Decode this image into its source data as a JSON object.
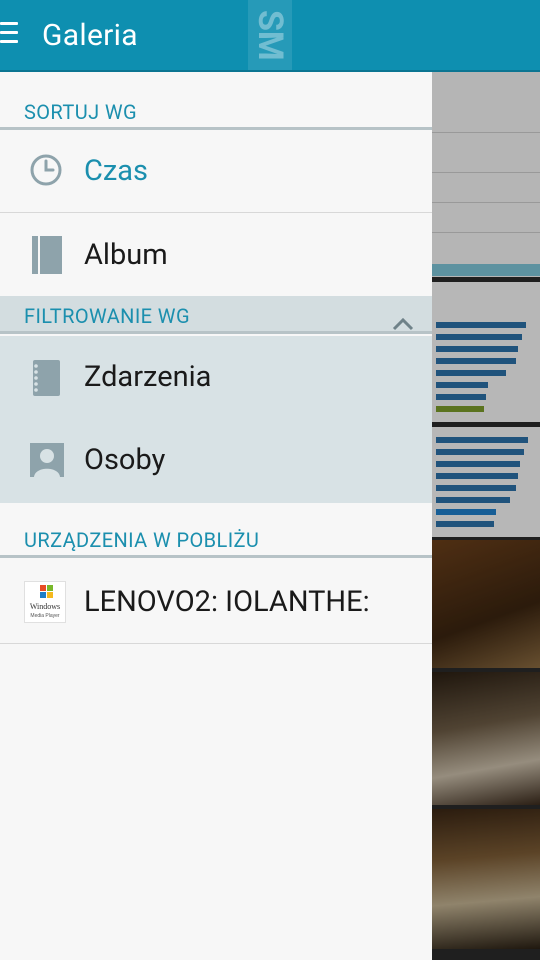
{
  "app": {
    "title": "Galeria",
    "watermark": "SM"
  },
  "drawer": {
    "sort_header": "SORTUJ WG",
    "sort_items": [
      {
        "label": "Czas",
        "icon": "clock-icon",
        "active": true
      },
      {
        "label": "Album",
        "icon": "album-icon",
        "active": false
      }
    ],
    "filter_header": "FILTROWANIE WG",
    "filter_items": [
      {
        "label": "Zdarzenia",
        "icon": "notebook-icon"
      },
      {
        "label": "Osoby",
        "icon": "person-icon"
      }
    ],
    "devices_header": "URZĄDZENIA W POBLIŻU",
    "device_items": [
      {
        "label": "LENOVO2: IOLANTHE:",
        "icon": "windows-media-player-icon",
        "icon_text_1": "Windows",
        "icon_text_2": "Media Player"
      }
    ]
  },
  "colors": {
    "accent": "#0e8fb0",
    "section_text": "#1b8fae",
    "filter_bg": "#d8e2e5"
  }
}
